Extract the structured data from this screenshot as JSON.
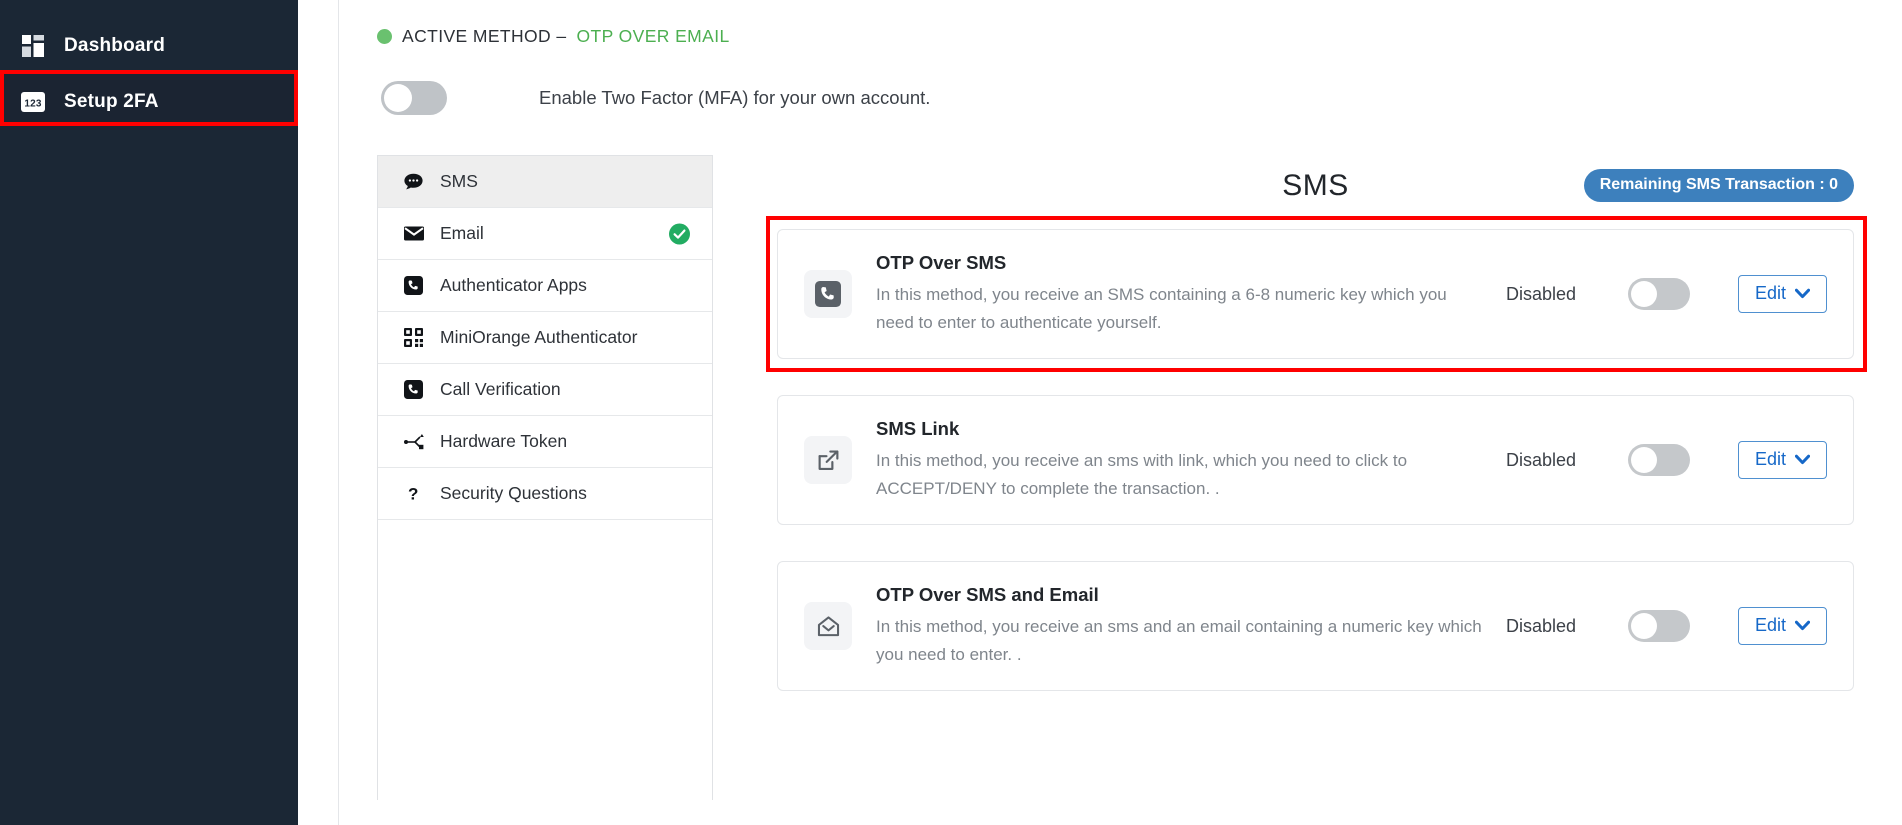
{
  "sidebar": {
    "items": [
      {
        "label": "Dashboard",
        "icon": "dashboard-grid-icon",
        "active": false
      },
      {
        "label": "Setup 2FA",
        "icon": "numeric-123-icon",
        "active": true
      }
    ]
  },
  "header": {
    "active_method_label": "ACTIVE METHOD –",
    "active_method_value": "OTP OVER EMAIL",
    "status_dot_color": "#6ac16f",
    "active_method_color": "#4caf50"
  },
  "mfa": {
    "toggle_state": "off",
    "description": "Enable Two Factor (MFA) for your own account."
  },
  "tabs": [
    {
      "label": "SMS",
      "icon": "chat-bubble-icon",
      "selected": true,
      "checked": false
    },
    {
      "label": "Email",
      "icon": "envelope-icon",
      "selected": false,
      "checked": true
    },
    {
      "label": "Authenticator Apps",
      "icon": "phone-square-icon",
      "selected": false,
      "checked": false
    },
    {
      "label": "MiniOrange Authenticator",
      "icon": "qr-code-icon",
      "selected": false,
      "checked": false
    },
    {
      "label": "Call Verification",
      "icon": "phone-square-icon",
      "selected": false,
      "checked": false
    },
    {
      "label": "Hardware Token",
      "icon": "usb-token-icon",
      "selected": false,
      "checked": false
    },
    {
      "label": "Security Questions",
      "icon": "question-mark-icon",
      "selected": false,
      "checked": false
    }
  ],
  "panel": {
    "title": "SMS",
    "badge_text": "Remaining SMS Transaction : 0",
    "badge_color": "#3d80bd",
    "cards": [
      {
        "icon": "phone-square-icon",
        "title": "OTP Over SMS",
        "description": "In this method, you receive an SMS containing a 6-8 numeric key which you need to enter to authenticate yourself.",
        "status": "Disabled",
        "toggle_state": "off",
        "edit_label": "Edit",
        "highlighted": true
      },
      {
        "icon": "external-link-icon",
        "title": "SMS Link",
        "description": "In this method, you receive an sms with link, which you need to click to ACCEPT/DENY to complete the transaction. .",
        "status": "Disabled",
        "toggle_state": "off",
        "edit_label": "Edit",
        "highlighted": false
      },
      {
        "icon": "open-envelope-icon",
        "title": "OTP Over SMS and Email",
        "description": "In this method, you receive an sms and an email containing a numeric key which you need to enter. .",
        "status": "Disabled",
        "toggle_state": "off",
        "edit_label": "Edit",
        "highlighted": false
      }
    ]
  },
  "annotations": {
    "highlight_color": "#ff0000"
  }
}
